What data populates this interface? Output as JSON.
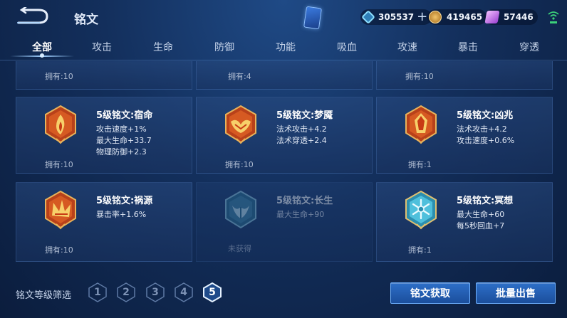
{
  "header": {
    "title": "铭文",
    "currencies": [
      {
        "name": "diamond",
        "value": "305537",
        "color": "#4fb8e8"
      },
      {
        "name": "gold",
        "value": "419465",
        "color": "#d9a64a"
      },
      {
        "name": "gem",
        "value": "57446",
        "color": "#c27ae0"
      }
    ]
  },
  "tabs": [
    "全部",
    "攻击",
    "生命",
    "防御",
    "功能",
    "吸血",
    "攻速",
    "暴击",
    "穿透"
  ],
  "top_row_owned": [
    "拥有:10",
    "拥有:4",
    "拥有:10"
  ],
  "runes": [
    {
      "name": "5级铭文:宿命",
      "stats": [
        "攻击速度+1%",
        "最大生命+33.7",
        "物理防御+2.3"
      ],
      "owned": "拥有:10",
      "color": "red",
      "icon": "flame-emblem-icon"
    },
    {
      "name": "5级铭文:梦魇",
      "stats": [
        "法术攻击+4.2",
        "法术穿透+2.4"
      ],
      "owned": "拥有:10",
      "color": "red",
      "icon": "wing-emblem-icon"
    },
    {
      "name": "5级铭文:凶兆",
      "stats": [
        "法术攻击+4.2",
        "攻击速度+0.6%"
      ],
      "owned": "拥有:1",
      "color": "red",
      "icon": "crystal-emblem-icon"
    },
    {
      "name": "5级铭文:祸源",
      "stats": [
        "暴击率+1.6%"
      ],
      "owned": "拥有:10",
      "color": "red",
      "icon": "fan-emblem-icon"
    },
    {
      "name": "5级铭文:长生",
      "stats": [
        "最大生命+90"
      ],
      "owned": "未获得",
      "color": "blue",
      "icon": "tail-emblem-icon",
      "locked": true
    },
    {
      "name": "5级铭文:冥想",
      "stats": [
        "最大生命+60",
        "每5秒回血+7"
      ],
      "owned": "拥有:1",
      "color": "blue",
      "icon": "snowflake-emblem-icon"
    }
  ],
  "filter": {
    "label": "铭文等级筛选",
    "levels": [
      "1",
      "2",
      "3",
      "4",
      "5"
    ],
    "selected": "5"
  },
  "buttons": {
    "acquire": "铭文获取",
    "bulk_sell": "批量出售"
  }
}
